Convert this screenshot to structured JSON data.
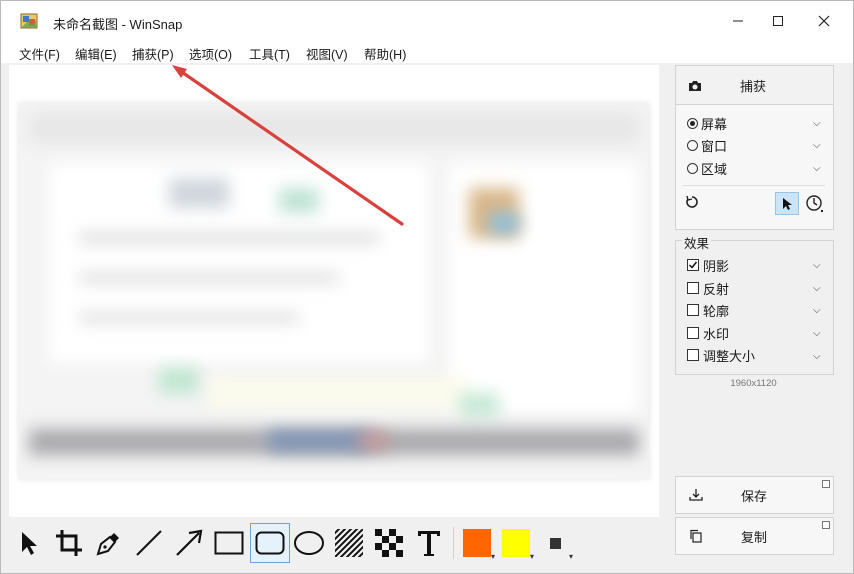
{
  "window": {
    "title": "未命名截图 - WinSnap",
    "minimize": "—",
    "maximize": "☐",
    "close": "✕"
  },
  "menu": {
    "items": [
      "文件(F)",
      "编辑(E)",
      "捕获(P)",
      "选项(O)",
      "工具(T)",
      "视图(V)",
      "帮助(H)"
    ]
  },
  "capture": {
    "button_label": "捕获",
    "modes": [
      {
        "label": "屏幕",
        "selected": true
      },
      {
        "label": "窗口",
        "selected": false
      },
      {
        "label": "区域",
        "selected": false
      }
    ]
  },
  "effects": {
    "group_label": "效果",
    "items": [
      {
        "label": "阴影",
        "checked": true
      },
      {
        "label": "反射",
        "checked": false
      },
      {
        "label": "轮廓",
        "checked": false
      },
      {
        "label": "水印",
        "checked": false
      },
      {
        "label": "调整大小",
        "checked": false
      }
    ]
  },
  "image_size": "1960x1120",
  "actions": {
    "save_label": "保存",
    "copy_label": "复制"
  },
  "toolbar": {
    "tools": [
      "pointer",
      "crop",
      "pen",
      "line",
      "arrow",
      "rectangle",
      "rounded-rectangle",
      "ellipse",
      "hatch",
      "pixelate",
      "text"
    ],
    "selected_tool": "rounded-rectangle",
    "primary_color": "#ff6600",
    "secondary_color": "#ffff00"
  },
  "annotation": {
    "arrow_color": "#d9413c"
  }
}
